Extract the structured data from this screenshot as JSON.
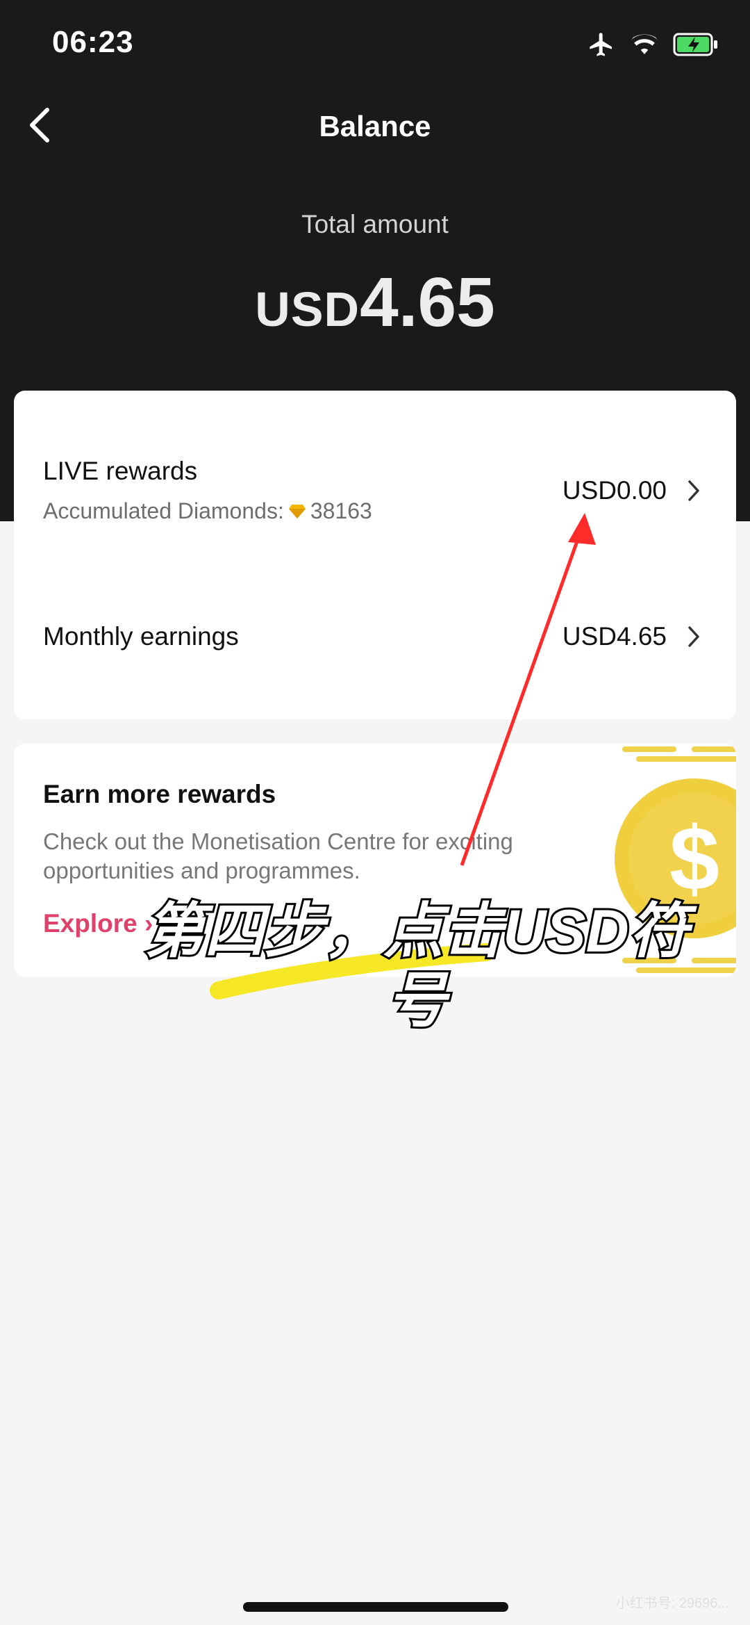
{
  "status_bar": {
    "time": "06:23"
  },
  "nav": {
    "title": "Balance"
  },
  "total": {
    "label": "Total amount",
    "currency": "USD",
    "amount": "4.65"
  },
  "rows": {
    "live": {
      "title": "LIVE rewards",
      "sub_label": "Accumulated Diamonds:",
      "diamonds": "38163",
      "value": "USD0.00"
    },
    "monthly": {
      "title": "Monthly earnings",
      "value": "USD4.65"
    }
  },
  "earn": {
    "title": "Earn more rewards",
    "desc": "Check out the Monetisation Centre for exciting opportunities and programmes.",
    "explore": "Explore"
  },
  "overlay": {
    "caption": "第四步，点击USD符号",
    "watermark": "小红书号: 29696..."
  },
  "colors": {
    "header": "#1a1a1a",
    "accent": "#e0416b",
    "arrow": "#ff2a2a",
    "highlight": "#f4e400"
  }
}
